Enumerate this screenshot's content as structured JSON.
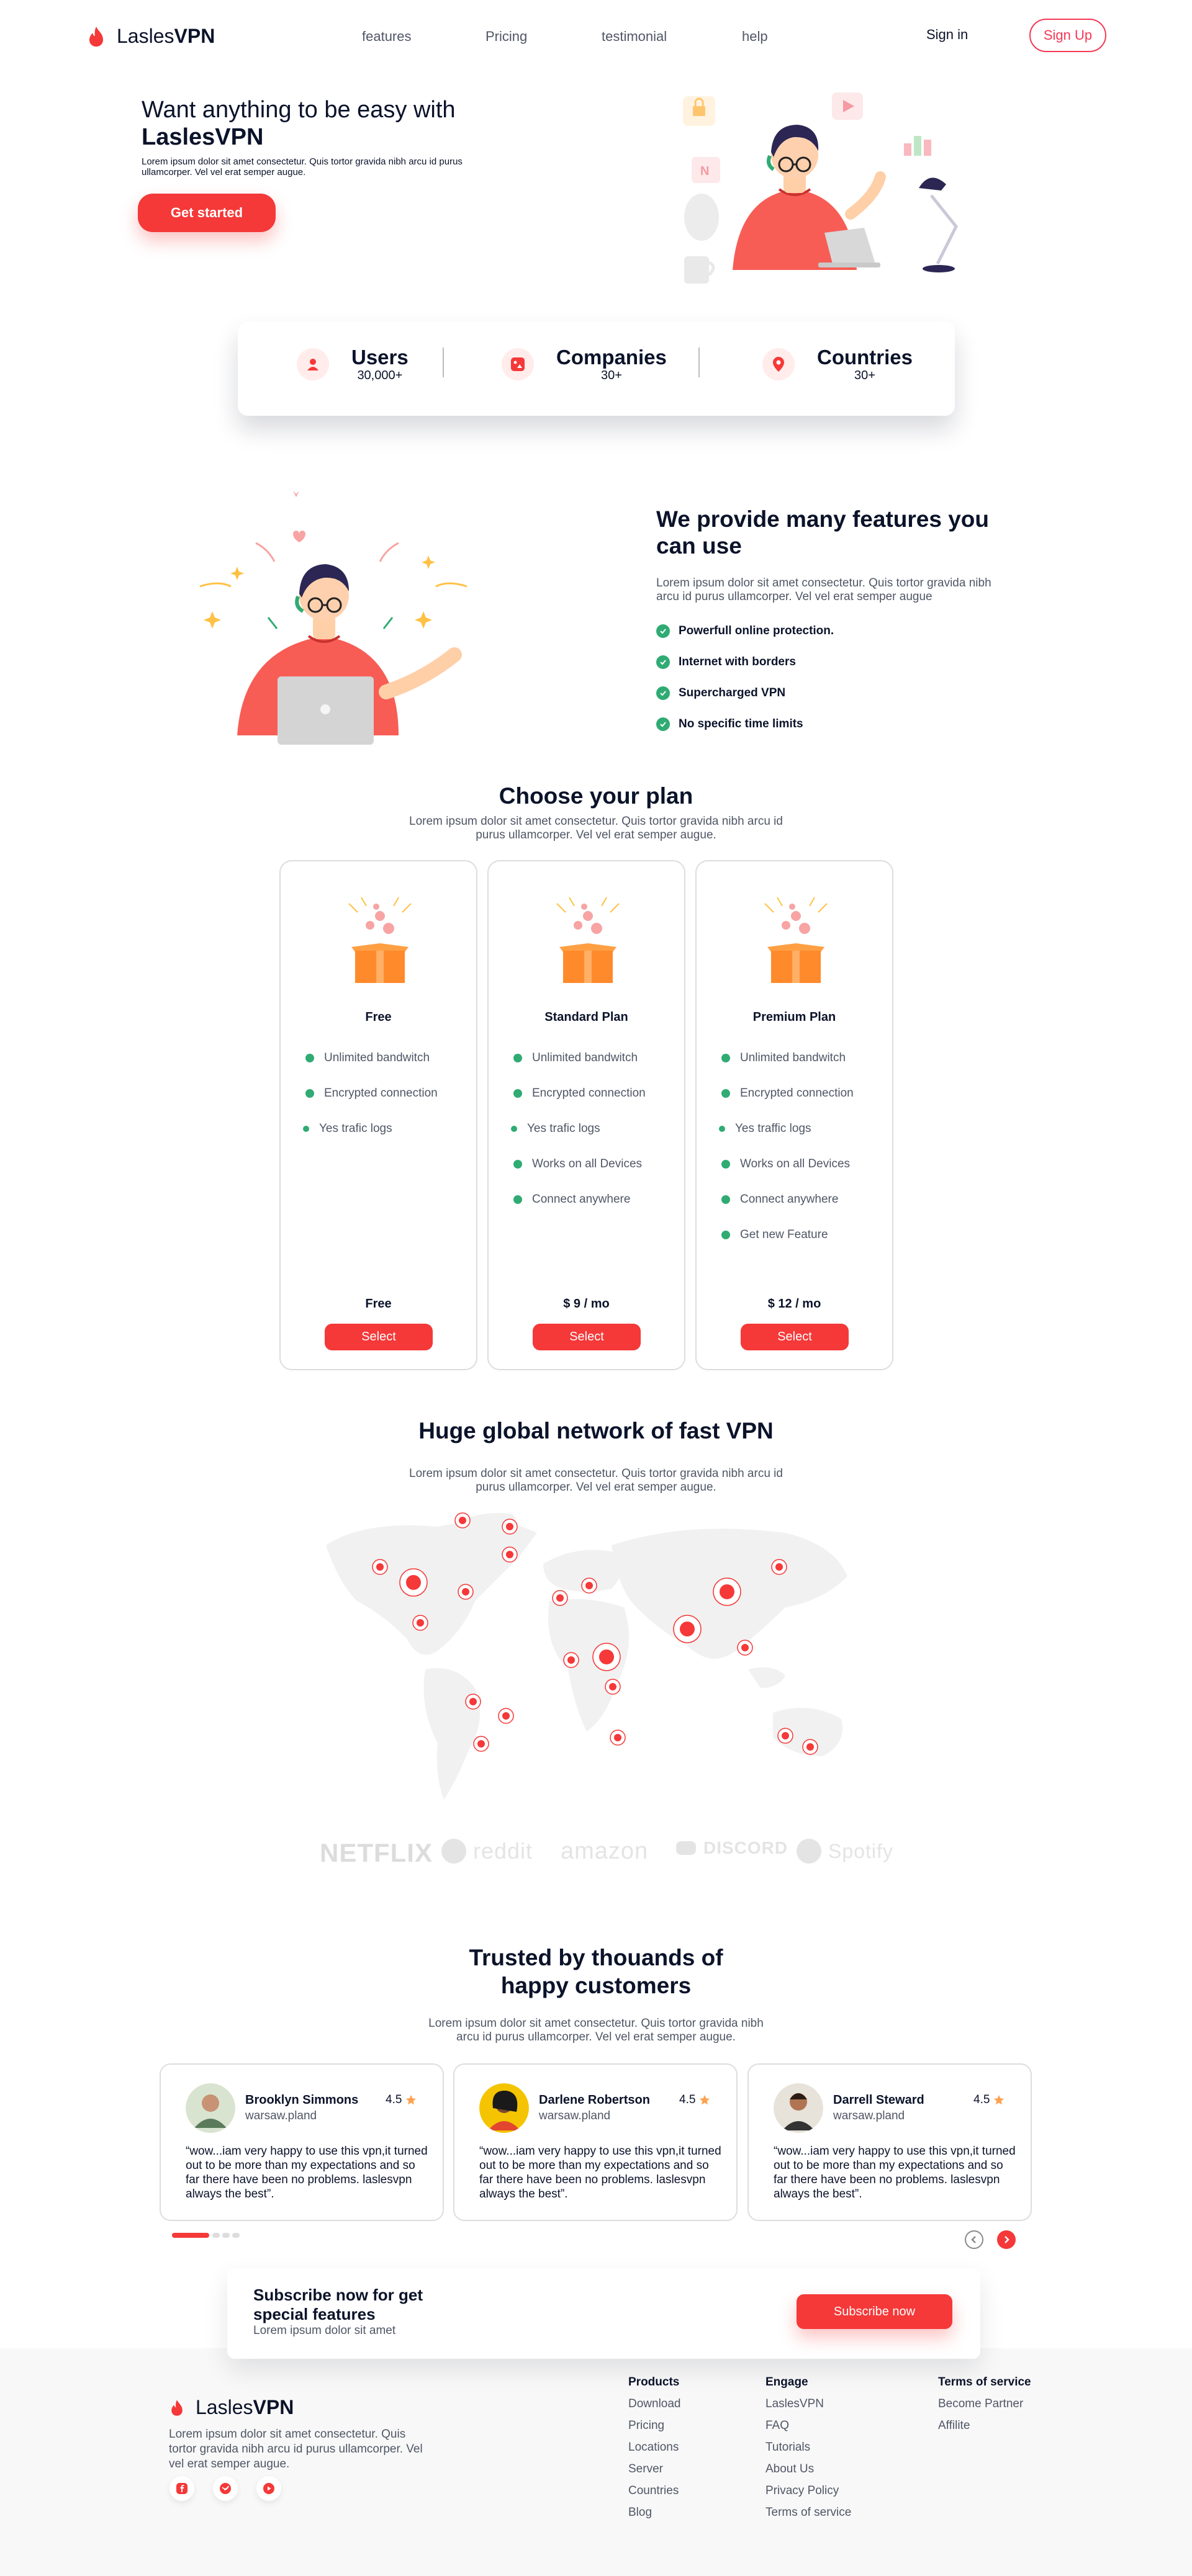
{
  "brand": {
    "name_light": "Lasles",
    "name_bold": "VPN"
  },
  "nav": {
    "links": [
      "features",
      "Pricing",
      "testimonial",
      "help"
    ],
    "signin": "Sign in",
    "signup": "Sign Up"
  },
  "hero": {
    "title_line1": "Want anything to be easy with",
    "title_line2": "LaslesVPN",
    "subtitle": "Lorem ipsum dolor sit amet consectetur. Quis tortor gravida nibh arcu id purus ullamcorper. Vel vel erat semper augue.",
    "cta": "Get started"
  },
  "stats": [
    {
      "label": "Users",
      "value": "30,000+",
      "icon": "user-icon"
    },
    {
      "label": "Companies",
      "value": "30+",
      "icon": "building-icon"
    },
    {
      "label": "Countries",
      "value": "30+",
      "icon": "location-pin-icon"
    }
  ],
  "features": {
    "title": "We provide many features you can use",
    "description": "Lorem ipsum dolor sit amet consectetur. Quis tortor gravida nibh arcu id purus ullamcorper. Vel vel erat semper augue",
    "items": [
      "Powerfull online protection.",
      "Internet with borders",
      "Supercharged VPN",
      "No specific time limits"
    ]
  },
  "plans": {
    "title": "Choose your plan",
    "subtitle_line1": "Lorem ipsum dolor sit amet consectetur. Quis tortor gravida nibh arcu id",
    "subtitle_line2": "purus ullamcorper. Vel vel erat semper augue.",
    "cards": [
      {
        "name": "Free",
        "features": [
          "Unlimited bandwitch",
          "Encrypted connection",
          "Yes trafic logs"
        ],
        "price": "Free",
        "button": "Select"
      },
      {
        "name": "Standard Plan",
        "features": [
          "Unlimited bandwitch",
          "Encrypted connection",
          "Yes trafic logs",
          "Works on all Devices",
          "Connect anywhere"
        ],
        "price": "$ 9 / mo",
        "button": "Select"
      },
      {
        "name": "Premium Plan",
        "features": [
          "Unlimited bandwitch",
          "Encrypted connection",
          "Yes traffic logs",
          "Works on all Devices",
          "Connect anywhere",
          "Get new Feature"
        ],
        "price": "$ 12 / mo",
        "button": "Select"
      }
    ]
  },
  "network": {
    "title": "Huge global network of fast VPN",
    "subtitle_line1": "Lorem ipsum dolor sit amet consectetur. Quis tortor gravida nibh arcu id",
    "subtitle_line2": "purus ullamcorper. Vel vel erat semper augue.",
    "partners": [
      "NETFLIX",
      "reddit",
      "amazon",
      "DISCORD",
      "Spotify"
    ]
  },
  "testimonials": {
    "title_line1": "Trusted by thouands of",
    "title_line2": "happy customers",
    "subtitle_line1": "Lorem ipsum dolor sit amet consectetur. Quis tortor gravida nibh",
    "subtitle_line2": "arcu id purus ullamcorper. Vel vel erat semper augue.",
    "items": [
      {
        "name": "Brooklyn Simmons",
        "location": "warsaw.pland",
        "rating": "4.5",
        "quote": "“wow...iam very happy to use this vpn,it turned out to be more than my expectations and so far there have been no problems. laslesvpn always the best”."
      },
      {
        "name": "Darlene Robertson",
        "location": "warsaw.pland",
        "rating": "4.5",
        "quote": "“wow...iam very happy to use this vpn,it turned out to be more than my expectations and so far there have been no problems. laslesvpn always the best”."
      },
      {
        "name": "Darrell Steward",
        "location": "warsaw.pland",
        "rating": "4.5",
        "quote": "“wow...iam very happy to use this vpn,it turned out to be more than my expectations and so far there have been no problems. laslesvpn always the best”."
      }
    ]
  },
  "subscribe": {
    "title_line1": "Subscribe now for get",
    "title_line2": "special features",
    "subtitle": "Lorem ipsum dolor sit amet",
    "button": "Subscribe now"
  },
  "footer": {
    "description": "Lorem ipsum dolor sit amet consectetur. Quis tortor gravida nibh arcu id purus ullamcorper. Vel vel erat semper augue.",
    "products_title": "Products",
    "products": [
      "Download",
      "Pricing",
      "Locations",
      "Server",
      "Countries",
      "Blog"
    ],
    "engage_title": "Engage",
    "engage": [
      "LaslesVPN",
      "FAQ",
      "Tutorials",
      "About Us",
      "Privacy Policy",
      "Terms of service"
    ],
    "terms_title": "Terms of service",
    "terms": [
      "Become Partner",
      "Affilite"
    ]
  },
  "colors": {
    "accent": "#f53838",
    "check": "#2fab73",
    "text": "#0b132a",
    "muted": "#4f5665"
  }
}
